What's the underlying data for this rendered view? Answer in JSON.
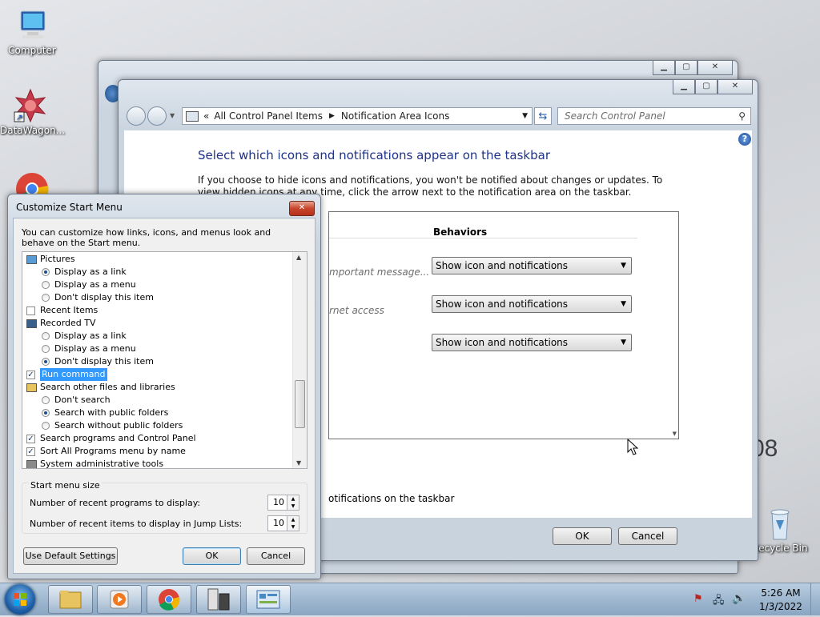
{
  "desktop": {
    "icons": [
      "Computer",
      "DataWagon...",
      "Recycle Bin"
    ],
    "watermark": "08"
  },
  "control_panel": {
    "breadcrumb_prefix": "«",
    "breadcrumb": [
      "All Control Panel Items",
      "Notification Area Icons"
    ],
    "search_placeholder": "Search Control Panel",
    "heading": "Select which icons and notifications appear on the taskbar",
    "intro": "If you choose to hide icons and notifications, you won't be notified about changes or updates. To view hidden icons at any time, click the arrow next to the notification area on the taskbar.",
    "behaviors_header": "Behaviors",
    "rows": [
      {
        "description": "mportant message...",
        "behavior": "Show icon and notifications"
      },
      {
        "description": "rnet access",
        "behavior": "Show icon and notifications"
      },
      {
        "description": "",
        "behavior": "Show icon and notifications"
      }
    ],
    "always_show_text": "otifications on the taskbar",
    "ok_label": "OK",
    "cancel_label": "Cancel"
  },
  "dialog": {
    "title": "Customize Start Menu",
    "description": "You can customize how links, icons, and menus look and behave on the Start menu.",
    "items": [
      {
        "type": "icon",
        "label": "Pictures",
        "icon": "pictures-icon"
      },
      {
        "type": "radio",
        "label": "Display as a link",
        "checked": true
      },
      {
        "type": "radio",
        "label": "Display as a menu",
        "checked": false
      },
      {
        "type": "radio",
        "label": "Don't display this item",
        "checked": false
      },
      {
        "type": "check",
        "label": "Recent Items",
        "checked": false
      },
      {
        "type": "icon",
        "label": "Recorded TV",
        "icon": "recorded-tv-icon"
      },
      {
        "type": "radio",
        "label": "Display as a link",
        "checked": false
      },
      {
        "type": "radio",
        "label": "Display as a menu",
        "checked": false
      },
      {
        "type": "radio",
        "label": "Don't display this item",
        "checked": true
      },
      {
        "type": "check",
        "label": "Run command",
        "checked": true,
        "selected": true
      },
      {
        "type": "icon",
        "label": "Search other files and libraries",
        "icon": "search-folder-icon"
      },
      {
        "type": "radio",
        "label": "Don't search",
        "checked": false
      },
      {
        "type": "radio",
        "label": "Search with public folders",
        "checked": true
      },
      {
        "type": "radio",
        "label": "Search without public folders",
        "checked": false
      },
      {
        "type": "check",
        "label": "Search programs and Control Panel",
        "checked": true
      },
      {
        "type": "check",
        "label": "Sort All Programs menu by name",
        "checked": true
      },
      {
        "type": "icon",
        "label": "System administrative tools",
        "icon": "admin-tools-icon"
      }
    ],
    "start_menu_size_label": "Start menu size",
    "recent_programs_label": "Number of recent programs to display:",
    "recent_programs_value": "10",
    "recent_items_label": "Number of recent items to display in Jump Lists:",
    "recent_items_value": "10",
    "default_button": "Use Default Settings",
    "ok_label": "OK",
    "cancel_label": "Cancel"
  },
  "taskbar": {
    "time": "5:26 AM",
    "date": "1/3/2022"
  }
}
